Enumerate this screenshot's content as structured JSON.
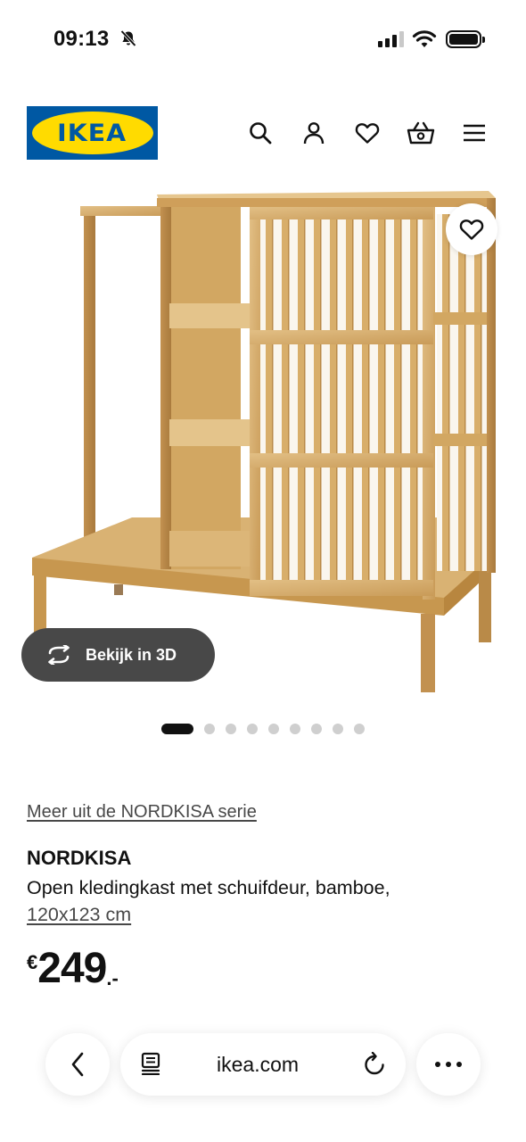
{
  "status_bar": {
    "time": "09:13"
  },
  "header": {
    "logo_text": "IKEA"
  },
  "colors": {
    "ikea_blue": "#0058a3",
    "ikea_yellow": "#ffdb00",
    "wood": "#d7b071",
    "button_dark": "#484848"
  },
  "gallery": {
    "view3d_label": "Bekijk in 3D",
    "image_count": 9,
    "active_index": 0
  },
  "product": {
    "series_link": "Meer uit de NORDKISA serie",
    "name": "NORDKISA",
    "description": "Open kledingkast met schuifdeur, bamboe,",
    "size": "120x123 cm",
    "price_currency": "€",
    "price_int": "249",
    "price_dec": ".-"
  },
  "browser": {
    "url": "ikea.com"
  }
}
